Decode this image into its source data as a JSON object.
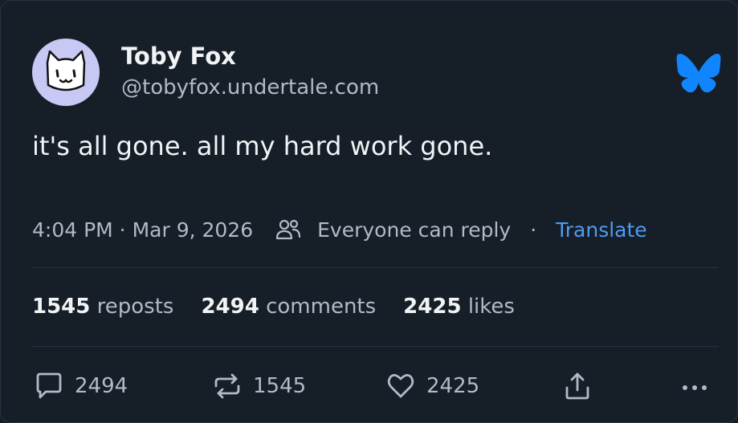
{
  "post": {
    "author_name": "Toby Fox",
    "author_handle": "@tobyfox.undertale.com",
    "text": "it's all gone. all my hard work gone.",
    "time": "4:04 PM",
    "date": "Mar 9, 2026",
    "time_date": "4:04 PM · Mar 9, 2026",
    "reply_setting": "Everyone can reply",
    "separator": "·",
    "translate_label": "Translate"
  },
  "stats": {
    "reposts_count": "1545",
    "reposts_label": "reposts",
    "comments_count": "2494",
    "comments_label": "comments",
    "likes_count": "2425",
    "likes_label": "likes"
  },
  "actions": {
    "reply_count": "2494",
    "repost_count": "1545",
    "like_count": "2425"
  },
  "icons": {
    "logo": "butterfly-icon",
    "reply_setting": "people-icon",
    "reply": "speech-bubble-icon",
    "repost": "repost-arrows-icon",
    "like": "heart-icon",
    "share": "share-icon",
    "more": "more-dots-icon"
  },
  "colors": {
    "background": "#161e27",
    "text": "#f1f3f5",
    "muted": "#aebbc9",
    "link": "#4f9bf2",
    "logo": "#1185fe",
    "avatar_bg": "#c7c8f4"
  }
}
